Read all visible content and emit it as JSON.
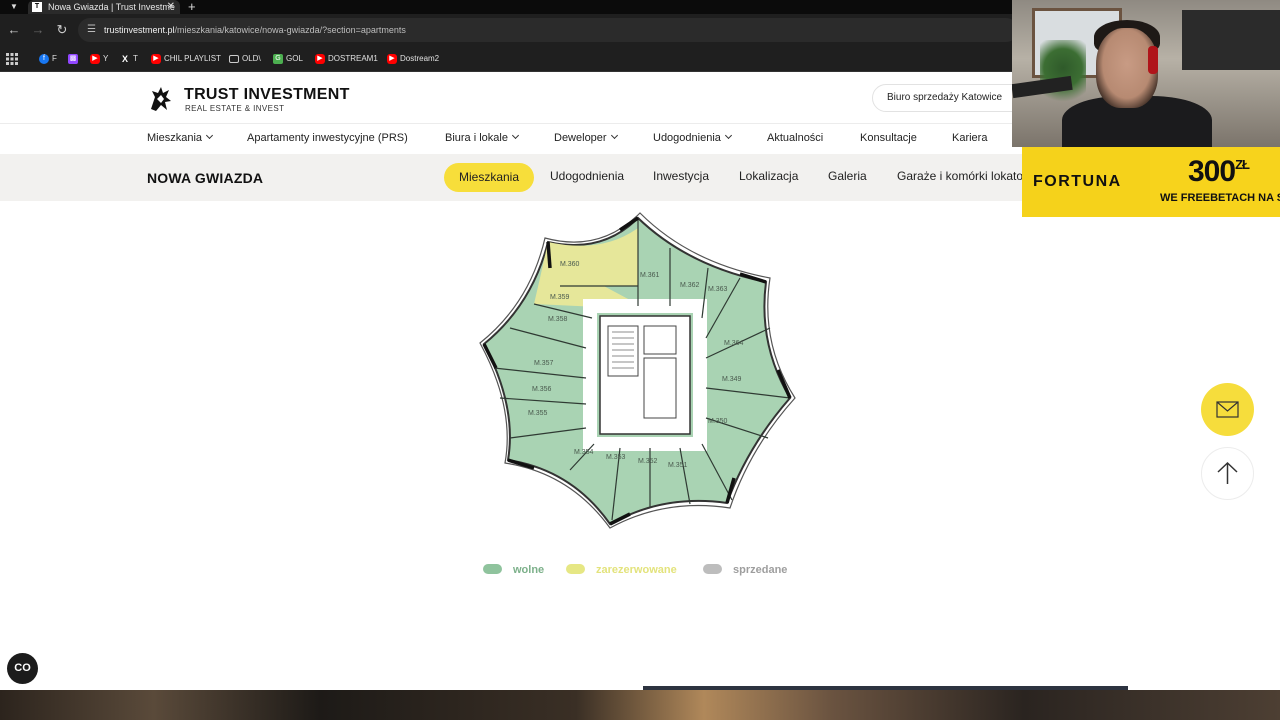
{
  "browser": {
    "tab_title": "Nowa Gwiazda | Trust Investme",
    "tab_favicon": "T",
    "url_domain": "trustinvestment.pl",
    "url_path": "/mieszkania/katowice/nowa-gwiazda/?section=apartments",
    "bookmarks": [
      {
        "label": "F",
        "icon": "facebook-icon",
        "color": "#1877f2"
      },
      {
        "label": "",
        "icon": "twitch-icon",
        "color": "#9146ff"
      },
      {
        "label": "Y",
        "icon": "youtube-icon",
        "color": "#ff0000"
      },
      {
        "label": "T",
        "icon": "x-icon",
        "color": "#000000"
      },
      {
        "label": "CHIL PLAYLIST",
        "icon": "youtube-icon",
        "color": "#ff0000"
      },
      {
        "label": "OLD\\",
        "icon": "folder-icon",
        "color": "#1f1f1f"
      },
      {
        "label": "GOL",
        "icon": "gol-icon",
        "color": "#4caf50"
      },
      {
        "label": "DOSTREAM1",
        "icon": "youtube-icon",
        "color": "#ff0000"
      },
      {
        "label": "Dostream2",
        "icon": "youtube-icon",
        "color": "#ff0000"
      }
    ]
  },
  "site": {
    "logo_title": "TRUST INVESTMENT",
    "logo_subtitle": "REAL ESTATE & INVEST",
    "sales_office": "Biuro sprzedaży Katowice",
    "main_nav": [
      {
        "label": "Mieszkania",
        "dropdown": true
      },
      {
        "label": "Apartamenty inwestycyjne (PRS)",
        "dropdown": false
      },
      {
        "label": "Biura i lokale",
        "dropdown": true
      },
      {
        "label": "Deweloper",
        "dropdown": true
      },
      {
        "label": "Udogodnienia",
        "dropdown": true
      },
      {
        "label": "Aktualności",
        "dropdown": false
      },
      {
        "label": "Konsultacje",
        "dropdown": false
      },
      {
        "label": "Kariera",
        "dropdown": false
      }
    ],
    "project_name": "NOWA GWIAZDA",
    "sub_nav": [
      {
        "label": "Mieszkania",
        "active": true
      },
      {
        "label": "Udogodnienia",
        "active": false
      },
      {
        "label": "Inwestycja",
        "active": false
      },
      {
        "label": "Lokalizacja",
        "active": false
      },
      {
        "label": "Galeria",
        "active": false
      },
      {
        "label": "Garaże i komórki lokatorskie",
        "active": false
      }
    ],
    "accent_color": "#f7de3a"
  },
  "floorplan": {
    "units": [
      {
        "label": "M.360",
        "status": "zarezerwowane"
      },
      {
        "label": "M.361",
        "status": "wolne"
      },
      {
        "label": "M.362",
        "status": "wolne"
      },
      {
        "label": "M.363",
        "status": "wolne"
      },
      {
        "label": "M.364",
        "status": "wolne"
      },
      {
        "label": "M.349",
        "status": "wolne"
      },
      {
        "label": "M.350",
        "status": "wolne"
      },
      {
        "label": "M.351",
        "status": "wolne"
      },
      {
        "label": "M.352",
        "status": "wolne"
      },
      {
        "label": "M.353",
        "status": "wolne"
      },
      {
        "label": "M.354",
        "status": "wolne"
      },
      {
        "label": "M.355",
        "status": "wolne"
      },
      {
        "label": "M.356",
        "status": "wolne"
      },
      {
        "label": "M.357",
        "status": "wolne"
      },
      {
        "label": "M.358",
        "status": "wolne"
      },
      {
        "label": "M.359",
        "status": "zarezerwowane"
      }
    ],
    "colors": {
      "wolne": "#a9d3b3",
      "zarezerwowane": "#e6e79a",
      "sprzedane": "#c9c9c9"
    }
  },
  "legend": [
    {
      "label": "wolne",
      "color": "#8fc39d",
      "text_color": "#7cb08a"
    },
    {
      "label": "zarezerwowane",
      "color": "#e6e784",
      "text_color": "#e3e37c"
    },
    {
      "label": "sprzedane",
      "color": "#bdbdbd",
      "text_color": "#9e9e9e"
    }
  ],
  "floating": {
    "mail_icon": "mail-icon",
    "up_icon": "arrow-up-icon",
    "cookie_icon": "cookie-settings-icon"
  },
  "ad": {
    "brand": "FORTUNA",
    "amount": "300",
    "currency": "ZŁ",
    "tagline": "WE FREEBETACH NA STAR"
  }
}
